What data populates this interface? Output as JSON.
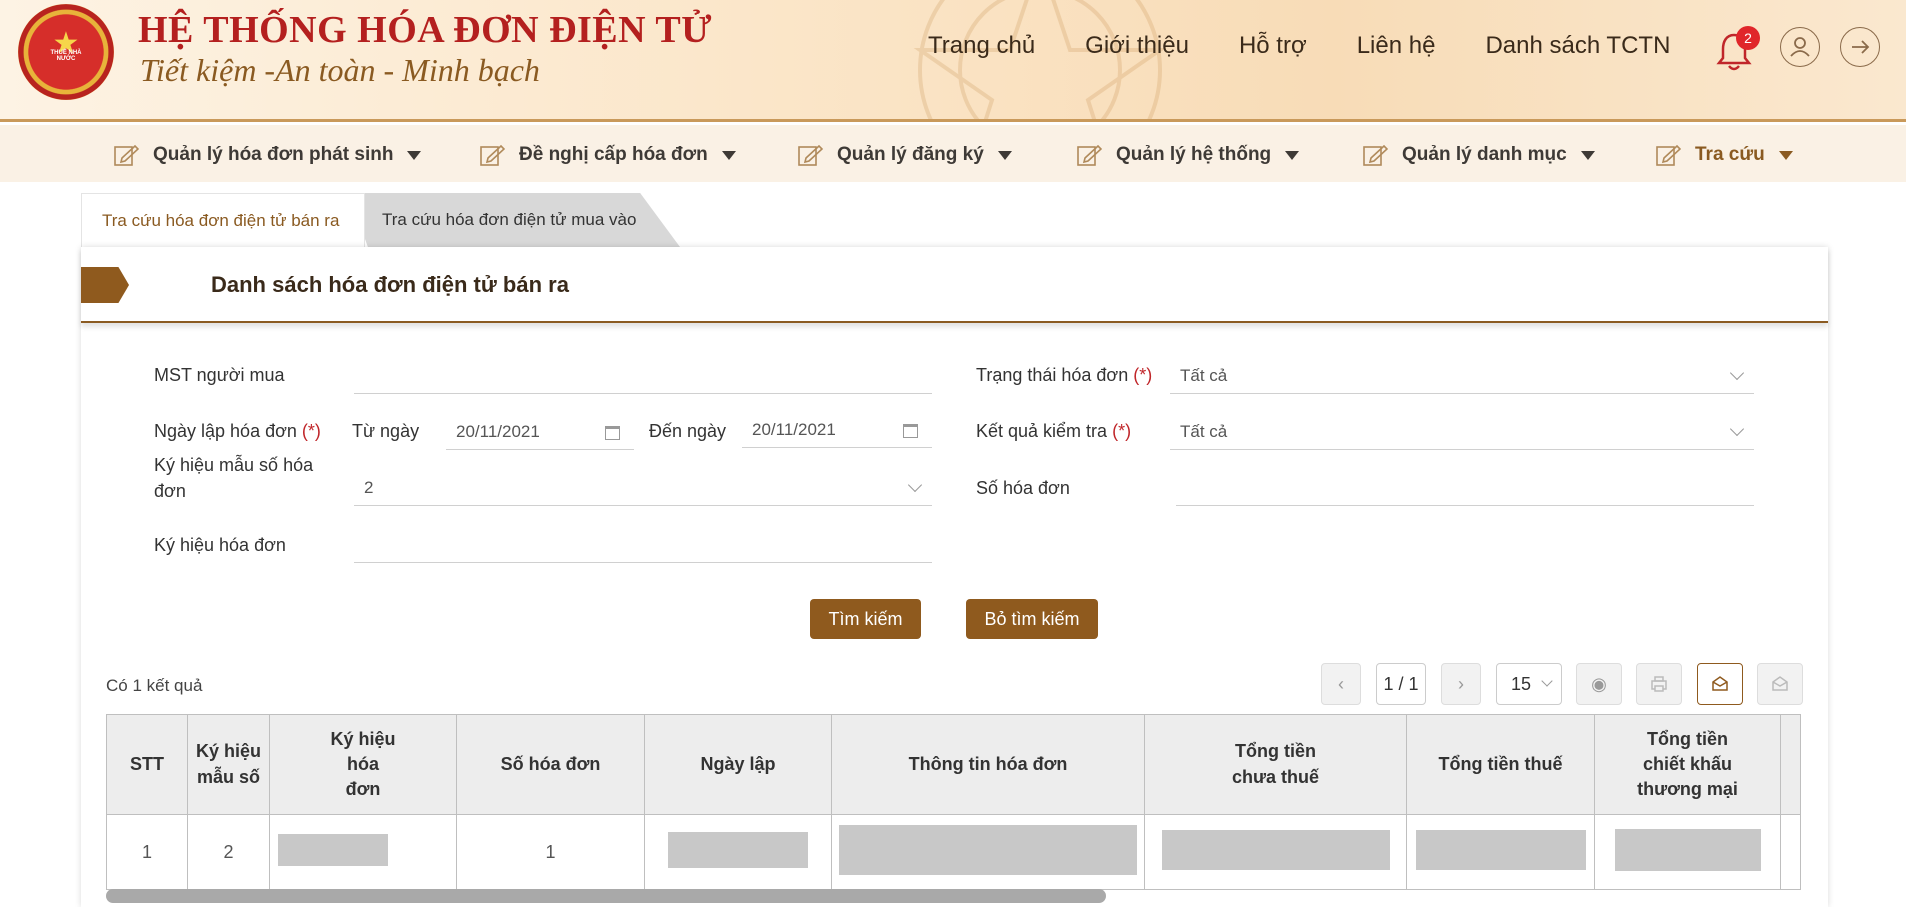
{
  "header": {
    "title": "HỆ THỐNG HÓA ĐƠN ĐIỆN TỬ",
    "slogan": "Tiết kiệm -An toàn - Minh bạch",
    "logo_text": "THUẾ NHÀ NƯỚC",
    "nav": [
      "Trang chủ",
      "Giới thiệu",
      "Hỗ trợ",
      "Liên hệ",
      "Danh sách TCTN"
    ],
    "notification_count": "2"
  },
  "menu": [
    {
      "label": "Quản lý hóa đơn phát sinh"
    },
    {
      "label": "Đề nghị cấp hóa đơn"
    },
    {
      "label": "Quản lý đăng ký"
    },
    {
      "label": "Quản lý hệ thống"
    },
    {
      "label": "Quản lý danh mục"
    },
    {
      "label": "Tra cứu"
    }
  ],
  "tabs": {
    "active": "Tra cứu hóa đơn điện tử bán ra",
    "inactive": "Tra cứu hóa đơn điện tử mua vào"
  },
  "panel": {
    "title": "Danh sách hóa đơn điện tử bán ra"
  },
  "form": {
    "buyer_tax_label": "MST người mua",
    "buyer_tax_value": "",
    "status_label": "Trạng thái hóa đơn",
    "status_value": "Tất cả",
    "date_label": "Ngày lập hóa đơn",
    "from_label": "Từ ngày",
    "from_value": "20/11/2021",
    "to_label": "Đến ngày",
    "to_value": "20/11/2021",
    "check_label": "Kết quả kiểm tra",
    "check_value": "Tất cả",
    "template_label": "Ký hiệu mẫu số hóa đơn",
    "template_value": "2",
    "invoice_no_label": "Số hóa đơn",
    "invoice_no_value": "",
    "symbol_label": "Ký hiệu hóa đơn",
    "symbol_value": "",
    "required_mark": "(*)"
  },
  "buttons": {
    "search": "Tìm kiếm",
    "clear": "Bỏ tìm kiếm"
  },
  "results": {
    "count_text": "Có 1 kết quả",
    "page": "1 / 1",
    "page_size": "15"
  },
  "table": {
    "headers": [
      "STT",
      "Ký hiệu mẫu số",
      "Ký hiệu hóa đơn",
      "Số hóa đơn",
      "Ngày lập",
      "Thông tin hóa đơn",
      "Tổng tiền chưa thuế",
      "Tổng tiền thuế",
      "Tổng tiền chiết khấu thương mại"
    ],
    "rows": [
      {
        "stt": "1",
        "template": "2",
        "invoice_no": "1"
      }
    ]
  },
  "colors": {
    "brand": "#8f5a1e",
    "title_red": "#b4201f",
    "badge": "#e0262a"
  }
}
